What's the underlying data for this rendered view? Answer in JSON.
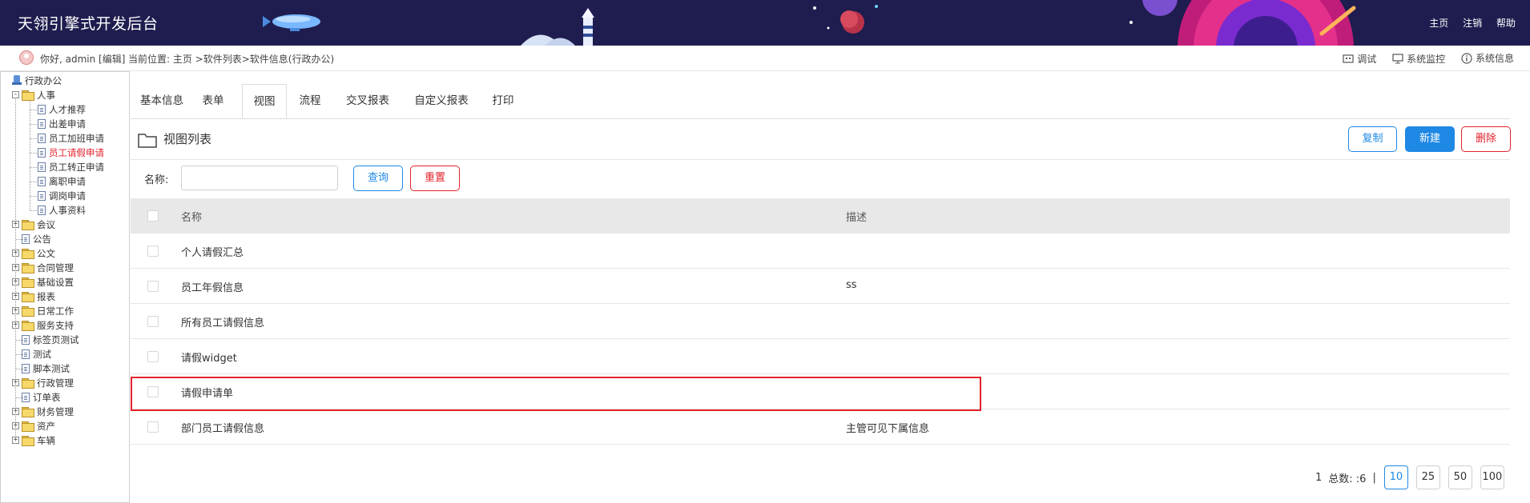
{
  "header": {
    "title": "天翎引擎式开发后台",
    "links": [
      "主页",
      "注销",
      "帮助"
    ]
  },
  "infobar": {
    "greeting": "你好, admin [编辑]",
    "location": "当前位置: 主页 >软件列表>软件信息(行政办公)",
    "tools": [
      {
        "label": "调试",
        "icon": "debug-icon"
      },
      {
        "label": "系统监控",
        "icon": "monitor-icon"
      },
      {
        "label": "系统信息",
        "icon": "info-icon"
      }
    ]
  },
  "tree": {
    "root": "行政办公",
    "hr": "人事",
    "hr_items": [
      "人才推荐",
      "出差申请",
      "员工加班申请",
      "员工请假申请",
      "员工转正申请",
      "离职申请",
      "调岗申请",
      "人事资料"
    ],
    "others": [
      {
        "label": "会议",
        "type": "folder"
      },
      {
        "label": "公告",
        "type": "page"
      },
      {
        "label": "公文",
        "type": "folder"
      },
      {
        "label": "合同管理",
        "type": "folder"
      },
      {
        "label": "基础设置",
        "type": "folder"
      },
      {
        "label": "报表",
        "type": "folder"
      },
      {
        "label": "日常工作",
        "type": "folder"
      },
      {
        "label": "服务支持",
        "type": "folder"
      },
      {
        "label": "标签页测试",
        "type": "page"
      },
      {
        "label": "测试",
        "type": "page"
      },
      {
        "label": "脚本测试",
        "type": "page"
      },
      {
        "label": "行政管理",
        "type": "folder"
      },
      {
        "label": "订单表",
        "type": "page"
      },
      {
        "label": "财务管理",
        "type": "folder"
      },
      {
        "label": "资产",
        "type": "folder"
      },
      {
        "label": "车辆",
        "type": "folder"
      }
    ]
  },
  "tabs": [
    "基本信息",
    "表单",
    "视图",
    "流程",
    "交叉报表",
    "自定义报表",
    "打印"
  ],
  "active_tab": "视图",
  "list": {
    "title": "视图列表",
    "copy": "复制",
    "new": "新建",
    "delete": "删除"
  },
  "search": {
    "label": "名称:",
    "value": "",
    "query": "查询",
    "reset": "重置"
  },
  "table": {
    "headers": [
      "名称",
      "描述"
    ],
    "rows": [
      {
        "name": "个人请假汇总",
        "desc": ""
      },
      {
        "name": "员工年假信息",
        "desc": "ss"
      },
      {
        "name": "所有员工请假信息",
        "desc": ""
      },
      {
        "name": "请假widget",
        "desc": ""
      },
      {
        "name": "请假申请单",
        "desc": ""
      },
      {
        "name": "部门员工请假信息",
        "desc": "主管可见下属信息"
      }
    ]
  },
  "pager": {
    "page": "1",
    "total": "总数: :6",
    "sep": "|",
    "sizes": [
      "10",
      "25",
      "50",
      "100"
    ],
    "active_size": "10"
  },
  "colors": {
    "header_bg": "#1f1d4f",
    "accent": "#1e88e5",
    "danger": "#e3222b"
  }
}
